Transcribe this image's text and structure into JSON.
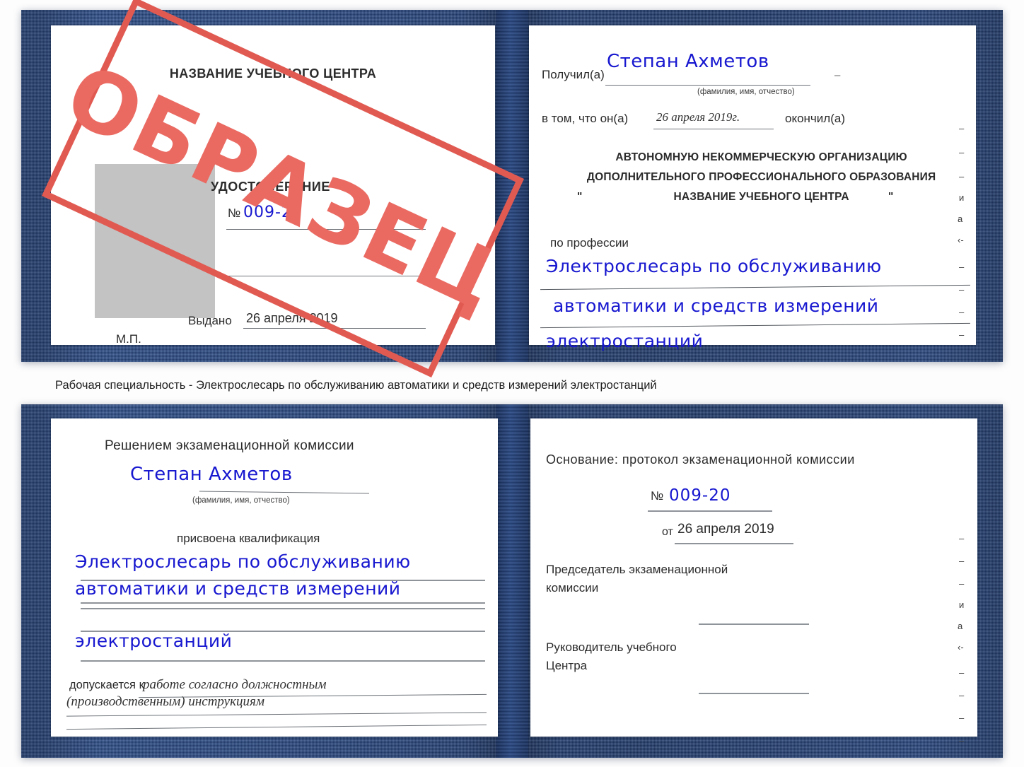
{
  "document": {
    "kind": "Удостоверение (сертификат) — разворот, 2 шт.",
    "stamp_text": "ОБРАЗЕЦ",
    "stamp_color": "#e15a52",
    "handwriting_color": "#1717d0",
    "cover_color": "#27467f"
  },
  "caption": "Рабочая специальность - Электрослесарь по обслуживанию автоматики и средств измерений электростанций",
  "cert_top": {
    "left_page": {
      "org_title": "НАЗВАНИЕ УЧЕБНОГО ЦЕНТРА",
      "doc_title": "УДОСТОВЕРЕНИЕ",
      "number_label": "№",
      "number_value": "009-20",
      "issued_label": "Выдано",
      "issued_value": "26 апреля 2019",
      "seal_label": "М.П.",
      "photo_placeholder": ""
    },
    "right_page": {
      "received_label": "Получил(а)",
      "received_value": "Степан Ахметов",
      "received_hint": "(фамилия, имя, отчество)",
      "in_that_label": "в том, что он(а)",
      "in_that_value": "26 апреля 2019г.",
      "finished_label": "окончил(а)",
      "org_line1": "АВТОНОМНУЮ НЕКОММЕРЧЕСКУЮ ОРГАНИЗАЦИЮ",
      "org_line2": "ДОПОЛНИТЕЛЬНОГО ПРОФЕССИОНАЛЬНОГО ОБРАЗОВАНИЯ",
      "org_quote_open": "\"",
      "org_line3": "НАЗВАНИЕ УЧЕБНОГО ЦЕНТРА",
      "org_quote_close": "\"",
      "profession_label": "по профессии",
      "profession_line1": "Электрослесарь по обслуживанию",
      "profession_line2": "автоматики и средств измерений",
      "profession_line3": "электростанций",
      "edge_marks": [
        "–",
        "–",
        "–",
        "и",
        "а",
        "‹-",
        "–",
        "–",
        "–",
        "–"
      ]
    }
  },
  "cert_bottom": {
    "left_page": {
      "commission_title": "Решением экзаменационной комиссии",
      "name_value": "Степан Ахметов",
      "name_hint": "(фамилия, имя, отчество)",
      "qualification_label": "присвоена квалификация",
      "qualification_line1": "Электрослесарь по обслуживанию",
      "qualification_line2": "автоматики и средств измерений",
      "qualification_line3": "электростанций",
      "allowed_label": "допускается к",
      "allowed_value_line1": "работе согласно должностным",
      "allowed_value_line2": "(производственным) инструкциям"
    },
    "right_page": {
      "basis_label": "Основание: протокол экзаменационной комиссии",
      "number_label": "№",
      "number_value": "009-20",
      "date_label": "от",
      "date_value": "26 апреля 2019",
      "chairman_line1": "Председатель экзаменационной",
      "chairman_line2": "комиссии",
      "head_line1": "Руководитель учебного",
      "head_line2": "Центра",
      "edge_marks": [
        "–",
        "–",
        "–",
        "и",
        "а",
        "‹-",
        "–",
        "–",
        "–",
        "–"
      ]
    }
  }
}
